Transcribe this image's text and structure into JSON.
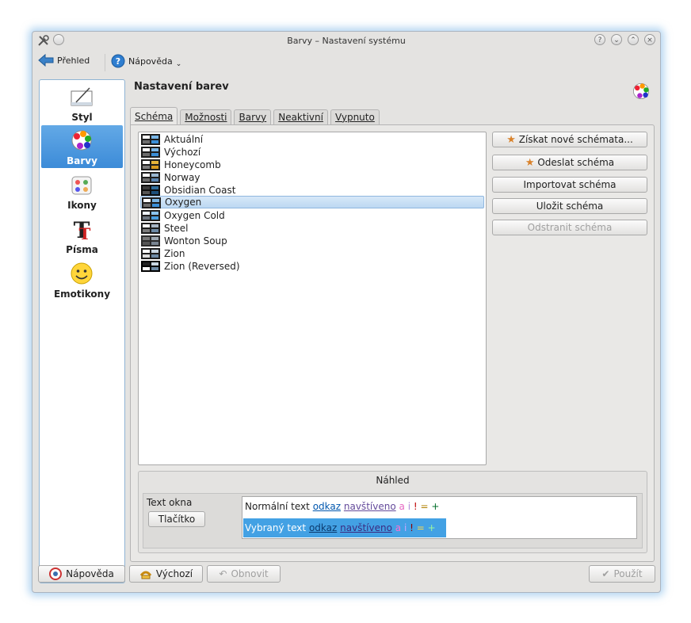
{
  "window": {
    "title": "Barvy – Nastavení systému"
  },
  "toolbar": {
    "overview_label": "Přehled",
    "help_label": "Nápověda"
  },
  "sidebar": {
    "items": [
      {
        "label": "Styl",
        "icon": "style-icon"
      },
      {
        "label": "Barvy",
        "icon": "colors-icon",
        "active": true
      },
      {
        "label": "Ikony",
        "icon": "icons-icon"
      },
      {
        "label": "Písma",
        "icon": "fonts-icon"
      },
      {
        "label": "Emotikony",
        "icon": "emoticons-icon"
      }
    ]
  },
  "main": {
    "heading": "Nastavení barev",
    "tabs": [
      "Schéma",
      "Možnosti",
      "Barvy",
      "Neaktivní",
      "Vypnuto"
    ],
    "schemes": [
      "Aktuální",
      "Výchozí",
      "Honeycomb",
      "Norway",
      "Obsidian Coast",
      "Oxygen",
      "Oxygen Cold",
      "Steel",
      "Wonton Soup",
      "Zion",
      "Zion (Reversed)"
    ],
    "selected_scheme": "Oxygen",
    "buttons": {
      "get_new": "Získat nové schémata...",
      "upload": "Odeslat schéma",
      "import": "Importovat schéma",
      "save": "Uložit schéma",
      "remove": "Odstranit schéma"
    },
    "preview": {
      "title": "Náhled",
      "window_text": "Text okna",
      "button_label": "Tlačítko",
      "normal_text": "Normální text",
      "selected_text": "Vybraný text",
      "link": "odkaz",
      "visited": "navštíveno",
      "symbols": [
        "a",
        "i",
        "!",
        "=",
        "+"
      ]
    }
  },
  "footer": {
    "help": "Nápověda",
    "defaults": "Výchozí",
    "reset": "Obnovit",
    "apply": "Použít"
  },
  "colors": {
    "selection": "#43a1e4",
    "link": "#0057ae",
    "visited": "#644a9b"
  }
}
